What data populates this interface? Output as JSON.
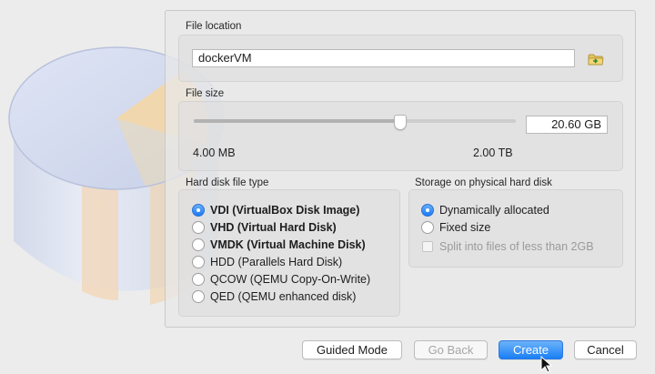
{
  "file_location": {
    "label": "File location",
    "value": "dockerVM",
    "folder_icon": "folder-icon"
  },
  "file_size": {
    "label": "File size",
    "value": "20.60 GB",
    "min_label": "4.00 MB",
    "max_label": "2.00 TB",
    "slider_fraction": 0.64
  },
  "disk_type": {
    "label": "Hard disk file type",
    "options": [
      {
        "label": "VDI (VirtualBox Disk Image)",
        "selected": true
      },
      {
        "label": "VHD (Virtual Hard Disk)",
        "selected": false
      },
      {
        "label": "VMDK (Virtual Machine Disk)",
        "selected": false
      },
      {
        "label": "HDD (Parallels Hard Disk)",
        "selected": false
      },
      {
        "label": "QCOW (QEMU Copy-On-Write)",
        "selected": false
      },
      {
        "label": "QED (QEMU enhanced disk)",
        "selected": false
      }
    ]
  },
  "storage": {
    "label": "Storage on physical hard disk",
    "options": [
      {
        "label": "Dynamically allocated",
        "selected": true
      },
      {
        "label": "Fixed size",
        "selected": false
      }
    ],
    "split_label": "Split into files of less than 2GB",
    "split_checked": false
  },
  "buttons": {
    "guided": "Guided Mode",
    "back": "Go Back",
    "create": "Create",
    "cancel": "Cancel"
  },
  "colors": {
    "accent": "#1b7af2",
    "window_bg": "#ececec"
  }
}
